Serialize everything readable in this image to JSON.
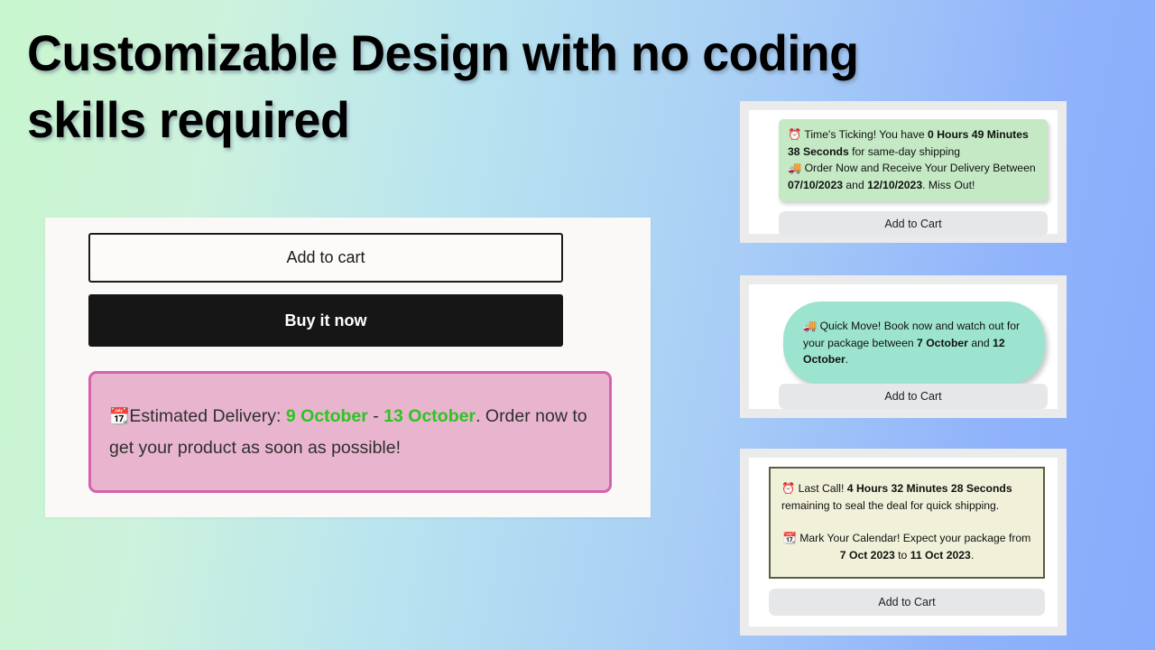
{
  "headline": "Customizable Design with no coding\nskills required",
  "theme": {
    "bg_gradient_start": "#c8f6cd",
    "bg_gradient_end": "#88acfb",
    "panel_bg": "#faf9f7",
    "buy_now_bg": "#161616",
    "delivery_banner_bg": "#e9b5ce",
    "delivery_banner_border": "#d463ab",
    "delivery_date_color": "#2ec322",
    "notice_green_bg": "#c4e9c4",
    "notice_mint_bg": "#9ce4cf",
    "notice_cream_bg": "#f1f0d9",
    "notice_cream_border": "#5c5c47",
    "card_frame_bg": "#ebebeb",
    "add_to_cart_bg": "#e6e7e9"
  },
  "product_panel": {
    "add_to_cart_label": "Add to cart",
    "buy_now_label": "Buy it now",
    "delivery": {
      "calendar_emoji": "📆",
      "prefix": "Estimated Delivery: ",
      "date_from": "9 October",
      "date_separator": " - ",
      "date_to": "13 October",
      "suffix": ". Order now to get your product as soon as possible!"
    }
  },
  "preview_cards": [
    {
      "id": "countdown-green",
      "style": "green-rounded",
      "clock_emoji": "⏰",
      "truck_emoji": "🚚",
      "line1_prefix": "Time's Ticking! You have ",
      "countdown": "0 Hours 49 Minutes 38 Seconds",
      "line1_suffix": " for same-day shipping",
      "line2_prefix": "Order Now and Receive Your Delivery Between ",
      "date_from": "07/10/2023",
      "date_join": " and ",
      "date_to": "12/10/2023",
      "line2_suffix": ". Miss Out!",
      "add_to_cart_label": "Add to Cart"
    },
    {
      "id": "quick-move-mint",
      "style": "mint-pill",
      "truck_emoji": "🚚",
      "text_prefix": "Quick Move! Book now and watch out for your package between ",
      "date_from": "7 October",
      "date_join": " and ",
      "date_to": "12 October",
      "text_suffix": ".",
      "add_to_cart_label": "Add to Cart"
    },
    {
      "id": "last-call-cream",
      "style": "cream-bordered",
      "clock_emoji": "⏰",
      "calendar_emoji": "📆",
      "line1_prefix": "Last Call! ",
      "countdown": "4 Hours 32 Minutes 28 Seconds",
      "line1_suffix": " remaining to seal the deal for quick shipping.",
      "line2_prefix": "Mark Your Calendar! Expect your package from ",
      "date_from": "7 Oct 2023",
      "date_join": " to ",
      "date_to": "11 Oct 2023",
      "line2_suffix": ".",
      "add_to_cart_label": "Add to Cart"
    }
  ]
}
